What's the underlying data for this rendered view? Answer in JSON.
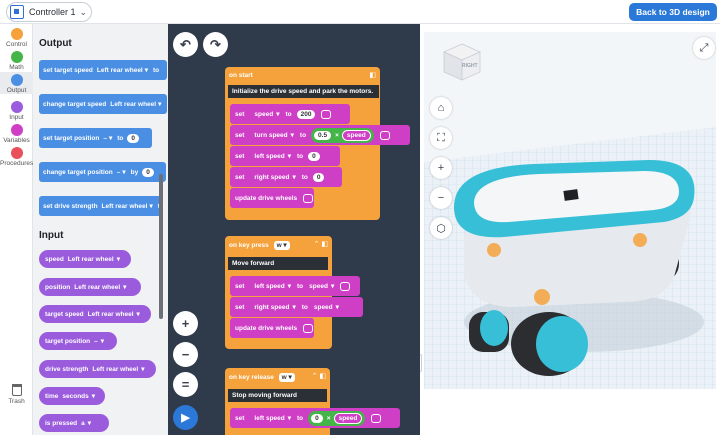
{
  "header": {
    "controller_label": "Controller 1",
    "back_button": "Back to 3D design"
  },
  "categories": [
    {
      "label": "Control",
      "color": "#f5a23c"
    },
    {
      "label": "Math",
      "color": "#45b54a"
    },
    {
      "label": "Output",
      "color": "#4a8fe4"
    },
    {
      "label": "Input",
      "color": "#9a5cdd"
    },
    {
      "label": "Variables",
      "color": "#cf3fc6"
    },
    {
      "label": "Procedures",
      "color": "#e8505b"
    }
  ],
  "trash_label": "Trash",
  "flyout": {
    "output_heading": "Output",
    "input_heading": "Input",
    "output_blocks": [
      {
        "text": "set target speed",
        "param": "Left rear wheel",
        "tail": "to"
      },
      {
        "text": "change target speed",
        "param": "Left rear wheel",
        "tail": ""
      },
      {
        "text": "set target position",
        "param": "–",
        "tail": "to",
        "value": "0"
      },
      {
        "text": "change target position",
        "param": "–",
        "tail": "by",
        "value": "0"
      },
      {
        "text": "set drive strength",
        "param": "Left rear wheel",
        "tail": "to"
      }
    ],
    "input_blocks": [
      {
        "text": "speed",
        "param": "Left rear wheel"
      },
      {
        "text": "position",
        "param": "Left rear wheel"
      },
      {
        "text": "target speed",
        "param": "Left rear wheel"
      },
      {
        "text": "target position",
        "param": "–"
      },
      {
        "text": "drive strength",
        "param": "Left rear wheel"
      },
      {
        "text": "time",
        "param": "seconds"
      },
      {
        "text": "is pressed",
        "param": "a"
      }
    ]
  },
  "workspace": {
    "on_start": {
      "title": "on start",
      "comment": "Initialize the drive speed and park the motors.",
      "rows": [
        {
          "verb": "set",
          "var": "speed",
          "to": "to",
          "value": "200"
        },
        {
          "verb": "set",
          "var": "turn speed",
          "to": "to",
          "value": "0.5",
          "op": "×",
          "ref": "speed"
        },
        {
          "verb": "set",
          "var": "left speed",
          "to": "to",
          "value": "0"
        },
        {
          "verb": "set",
          "var": "right speed",
          "to": "to",
          "value": "0"
        },
        {
          "verb": "update drive wheels"
        }
      ]
    },
    "on_key_press": {
      "title": "on key press",
      "key": "w",
      "comment": "Move forward",
      "rows": [
        {
          "verb": "set",
          "var": "left speed",
          "to": "to",
          "ref": "speed"
        },
        {
          "verb": "set",
          "var": "right speed",
          "to": "to",
          "ref": "speed"
        },
        {
          "verb": "update drive wheels"
        }
      ]
    },
    "on_key_release": {
      "title": "on key release",
      "key": "w",
      "comment": "Stop moving forward",
      "rows": [
        {
          "verb": "set",
          "var": "left speed",
          "to": "to",
          "value": "0",
          "op": "×",
          "ref": "speed"
        }
      ]
    },
    "undo_icon": "undo-icon",
    "redo_icon": "redo-icon",
    "zoom_in": "+",
    "zoom_out": "−",
    "zoom_reset": "=",
    "run_icon": "play-icon"
  },
  "viewer": {
    "cube_label": "RIGHT",
    "tools": [
      "home-icon",
      "fit-view-icon",
      "zoom-in-icon",
      "zoom-out-icon",
      "view-cube-icon"
    ],
    "zoom_in": "+",
    "zoom_out": "−"
  }
}
